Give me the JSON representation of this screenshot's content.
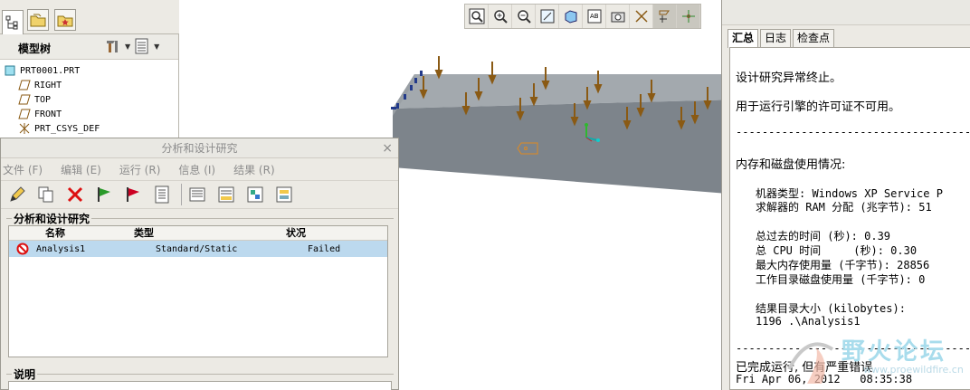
{
  "left_tabs": [
    "model-tree-tab",
    "folder-tab",
    "favorites-tab"
  ],
  "model_tree": {
    "title": "模型树",
    "items": [
      {
        "label": "PRT0001.PRT",
        "icon": "part-icon"
      },
      {
        "label": "RIGHT",
        "icon": "datum-plane-icon"
      },
      {
        "label": "TOP",
        "icon": "datum-plane-icon"
      },
      {
        "label": "FRONT",
        "icon": "datum-plane-icon"
      },
      {
        "label": "PRT_CSYS_DEF",
        "icon": "csys-icon"
      }
    ]
  },
  "view_toolbar": [
    "zoom-window-icon",
    "zoom-in-icon",
    "zoom-out-icon",
    "refit-icon",
    "shading-icon",
    "annotation-icon",
    "photo-icon",
    "datum-display-icon",
    "axis-display-icon",
    "csys-display-icon"
  ],
  "dialog": {
    "title": "分析和设计研究",
    "close": "×",
    "menu": [
      "文件 (F)",
      "编辑 (E)",
      "运行 (R)",
      "信息 (I)",
      "结果 (R)"
    ],
    "toolbar": [
      "edit-icon",
      "copy-icon",
      "delete-icon",
      "start-flag-icon",
      "stop-flag-icon",
      "status-icon",
      "review-icon",
      "results-icon",
      "optimize-icon",
      "export-icon"
    ],
    "group_label": "分析和设计研究",
    "columns": [
      "名称",
      "类型",
      "状况"
    ],
    "rows": [
      {
        "name": "Analysis1",
        "type": "Standard/Static",
        "status": "Failed"
      }
    ],
    "desc_label": "说明"
  },
  "summary": {
    "tabs": [
      "汇总",
      "日志",
      "检查点"
    ],
    "active_tab": "汇总",
    "lines": {
      "l1": "设计研究异常终止。",
      "l2": "用于运行引擎的许可证不可用。",
      "sep1": "--------------------------------------------",
      "l3": "内存和磁盘使用情况:",
      "l4": "机器类型: Windows XP Service P",
      "l5": "求解器的 RAM 分配 (兆字节): 51",
      "l6": "总过去的时间 (秒): 0.39",
      "l7": "总 CPU 时间     (秒): 0.30",
      "l8": "最大内存使用量 (千字节): 28856",
      "l9": "工作目录磁盘使用量 (千字节): 0",
      "l10": "结果目录大小 (kilobytes):",
      "l11": "1196 .\\Analysis1",
      "sep2": "--------------------------------------------",
      "l12": "已完成运行, 但有严重错误",
      "l13": "Fri Apr 06, 2012   08:35:38"
    }
  },
  "watermark": {
    "text": "野火论坛",
    "url": "www.proewildfire.cn"
  },
  "colors": {
    "selected_row": "#bcd9ee",
    "model_gray": "#7d848b",
    "load_arrow": "#8a5a14",
    "panel_bg": "#eceae4"
  }
}
